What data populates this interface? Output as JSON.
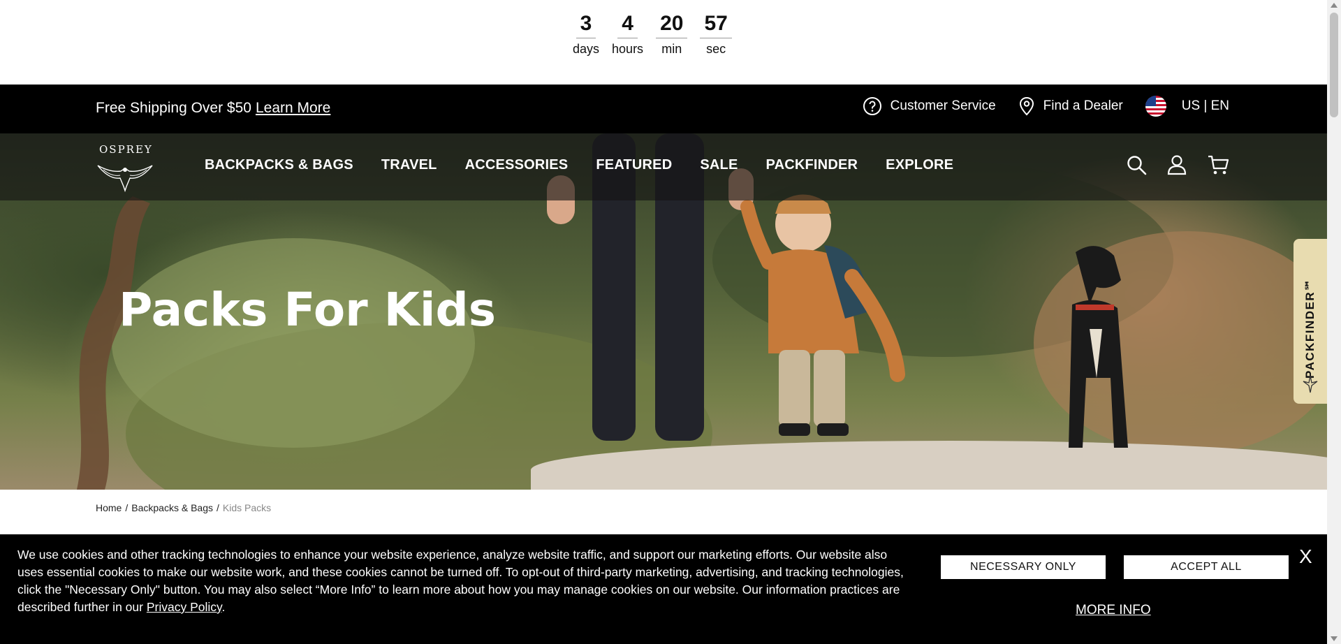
{
  "countdown": {
    "units": [
      {
        "value": "3",
        "label": "days"
      },
      {
        "value": "4",
        "label": "hours"
      },
      {
        "value": "20",
        "label": "min"
      },
      {
        "value": "57",
        "label": "sec"
      }
    ]
  },
  "topbar": {
    "shipping_text": "Free Shipping Over $50",
    "learn_more": "Learn More",
    "customer_service": "Customer Service",
    "find_dealer": "Find a Dealer",
    "locale": "US | EN"
  },
  "header": {
    "logo_text": "OSPREY",
    "nav": [
      "BACKPACKS & BAGS",
      "TRAVEL",
      "ACCESSORIES",
      "FEATURED",
      "SALE",
      "PACKFINDER",
      "EXPLORE"
    ]
  },
  "hero": {
    "title": "Packs For Kids",
    "packfinder_tab": "PACKFINDER℠"
  },
  "breadcrumb": {
    "items": [
      "Home",
      "Backpacks & Bags",
      "Kids Packs"
    ],
    "separator": "/"
  },
  "cookie": {
    "text": "We use cookies and other tracking technologies to enhance your website experience, analyze website traffic, and support our marketing efforts. Our website also uses essential cookies to make our website work, and these cookies cannot be turned off. To opt-out of third-party marketing, advertising, and tracking technologies, click the \"Necessary Only\" button. You may also select “More Info” to learn more about how you may manage cookies on our website. Our information practices are described further in our",
    "privacy_link": "Privacy Policy",
    "text_end": ".",
    "necessary_only": "NECESSARY ONLY",
    "accept_all": "ACCEPT ALL",
    "more_info": "MORE INFO",
    "close": "X"
  },
  "icons": {
    "help": "question-circle-icon",
    "location": "map-pin-icon",
    "flag": "us-flag-icon",
    "search": "search-icon",
    "account": "user-icon",
    "cart": "cart-icon"
  }
}
